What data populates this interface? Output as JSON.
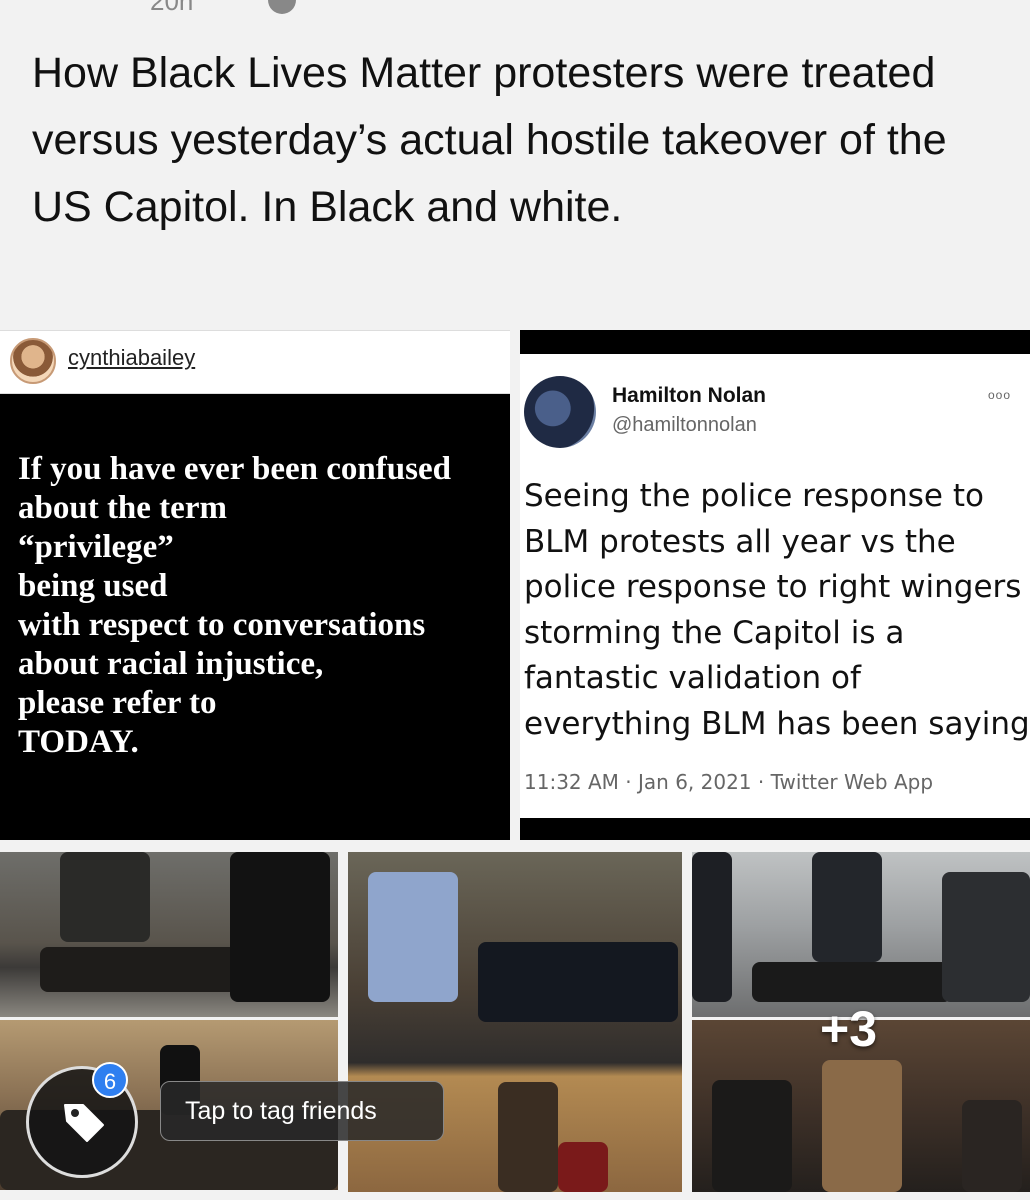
{
  "header": {
    "time_partial": "20h"
  },
  "post": {
    "caption": "How Black Lives Matter protesters were treated versus yesterday’s actual hostile takeover of the US Capitol. In Black and white."
  },
  "instagram_card": {
    "username": "cynthiabailey",
    "quote_lines": [
      "If you have ever been confused",
      "about the term",
      "“privilege”",
      "being used",
      "with respect to conversations",
      "about racial injustice,",
      "please refer to",
      "TODAY."
    ]
  },
  "tweet_card": {
    "name": "Hamilton Nolan",
    "handle": "@hamiltonnolan",
    "more": "ooo",
    "text_lines": [
      "Seeing the police response to",
      "BLM protests all year vs the",
      "police response to right wingers",
      "storming the Capitol is a",
      "fantastic validation of",
      "everything BLM has been saying"
    ],
    "meta": "11:32 AM · Jan 6, 2021 · Twitter Web App"
  },
  "photos": {
    "more_count": "+3"
  },
  "tagging": {
    "badge_count": "6",
    "tooltip": "Tap to tag friends"
  },
  "colors": {
    "badge": "#2f7ff0",
    "background": "#f2f2f2"
  }
}
